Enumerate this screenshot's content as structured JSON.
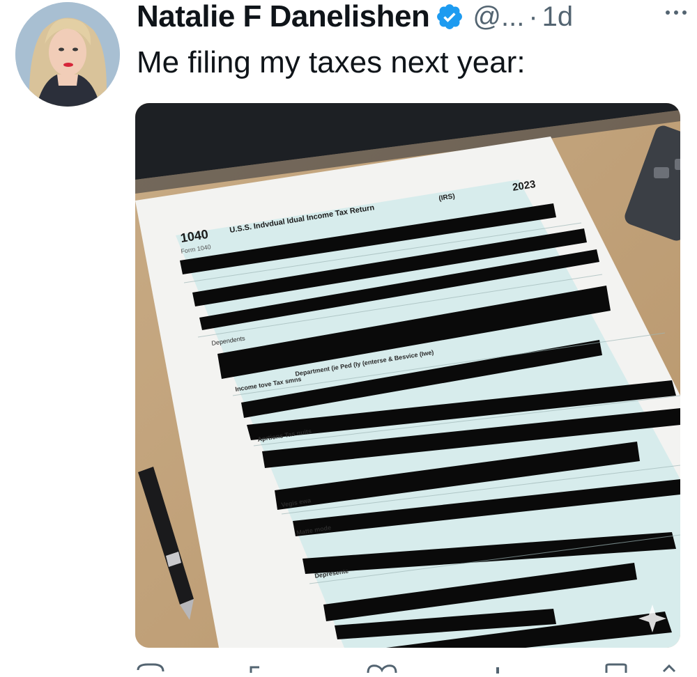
{
  "tweet": {
    "author_name": "Natalie F Danelishen",
    "handle": "@...",
    "separator": "·",
    "timestamp": "1d",
    "text": "Me filing my taxes next year:"
  },
  "media": {
    "form_number": "1040",
    "form_sub": "Form 1040",
    "form_title": "U.S.S. Indvdual Idual Income Tax Return",
    "irs_tag": "(IRS)",
    "year": "2023",
    "section_labels": [
      "Dependents",
      "Income tove Tax smns",
      "Aprtions Tas nuits",
      "Vegis ewa",
      "Matte mode",
      "Depresente"
    ],
    "dept_line": "Department (ie Ped (Iy (enterse & Besvice (Iwe)"
  },
  "icons": [
    "verified-badge-icon",
    "more-options-icon",
    "reply-icon",
    "retweet-icon",
    "like-icon",
    "views-icon",
    "bookmark-icon",
    "share-icon"
  ],
  "colors": {
    "verified": "#1d9bf0",
    "secondary_text": "#536471"
  }
}
